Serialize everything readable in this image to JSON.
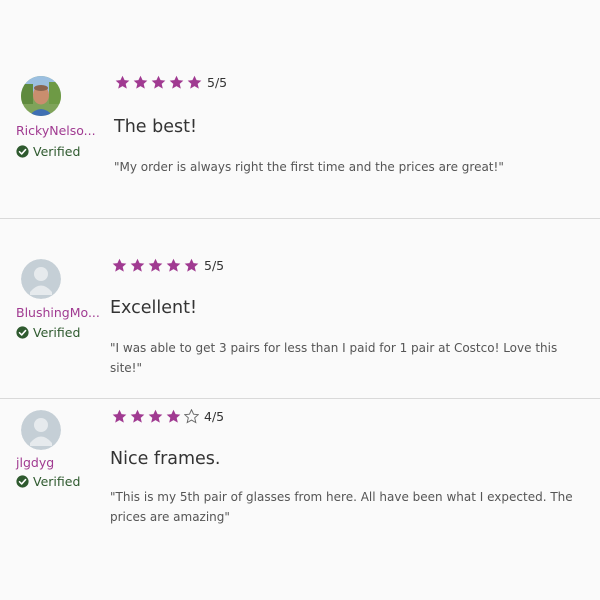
{
  "colors": {
    "star_filled": "#a03a91",
    "username": "#a03a91",
    "verified_green": "#2f5a2f",
    "divider": "#d9d9d9"
  },
  "reviews": [
    {
      "username": "RickyNelso...",
      "verified_label": "Verified",
      "avatar": "user-photo",
      "rating": 5,
      "rating_text": "5/5",
      "title": "The best!",
      "body": "\"My order is always right the first time and the prices are great!\""
    },
    {
      "username": "BlushingMo...",
      "verified_label": "Verified",
      "avatar": "default-user-icon",
      "rating": 5,
      "rating_text": "5/5",
      "title": "Excellent!",
      "body": "\"I was able to get 3 pairs for less than I paid for 1 pair at Costco! Love this site!\""
    },
    {
      "username": "jlgdyg",
      "verified_label": "Verified",
      "avatar": "default-user-icon",
      "rating": 4,
      "rating_text": "4/5",
      "title": "Nice frames.",
      "body": "\"This is my 5th pair of glasses from here. All have been what I expected. The prices are amazing\""
    }
  ]
}
